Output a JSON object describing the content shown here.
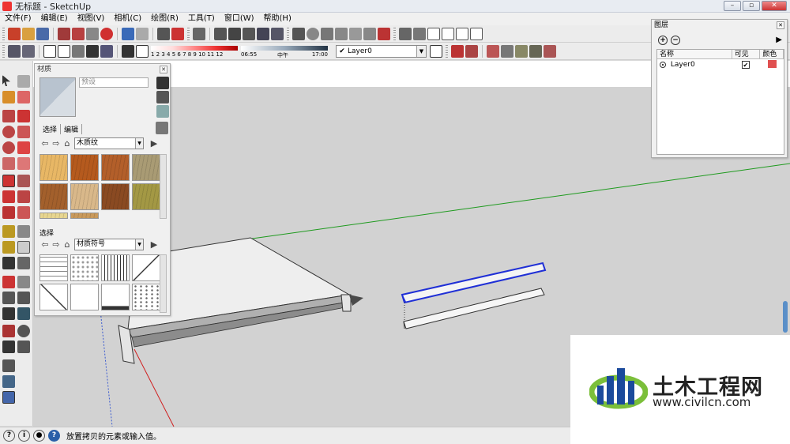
{
  "window": {
    "title": "无标题 - SketchUp"
  },
  "menu": [
    "文件(F)",
    "编辑(E)",
    "视图(V)",
    "相机(C)",
    "绘图(R)",
    "工具(T)",
    "窗口(W)",
    "帮助(H)"
  ],
  "toolbar": {
    "shadow_ticks": "1 2 3 4 5 6 7 8 9 10 11 12",
    "time_start": "06:55",
    "time_mid": "中午",
    "time_end": "17:00",
    "layer_current": "Layer0"
  },
  "materials_panel": {
    "title": "材质",
    "name_placeholder": "预设",
    "tab_select": "选择",
    "tab_edit": "编辑",
    "library1": "木质纹",
    "select_label": "选择",
    "library2": "材质符号",
    "wood_swatches": [
      "#e8b765",
      "#b55a1e",
      "#b35f2a",
      "#a99b74",
      "#a3602c",
      "#d9b88a",
      "#8a4a22",
      "#a39844",
      "#e8d690",
      "#c99a5c"
    ]
  },
  "layers_panel": {
    "title": "图层",
    "col_name": "名称",
    "col_visible": "可见",
    "col_color": "颜色",
    "rows": [
      {
        "name": "Layer0",
        "visible": true,
        "color": "#e05050"
      }
    ]
  },
  "status": {
    "message": "放置拷贝的元素或输入值。"
  },
  "watermark": {
    "text": "土木工程网",
    "url": "www.civilcn.com"
  },
  "colors": {
    "selection_blue": "#1f2fd6",
    "axis_green": "#1e9a1e",
    "axis_red": "#d02020",
    "axis_blue": "#3a5ad0"
  }
}
